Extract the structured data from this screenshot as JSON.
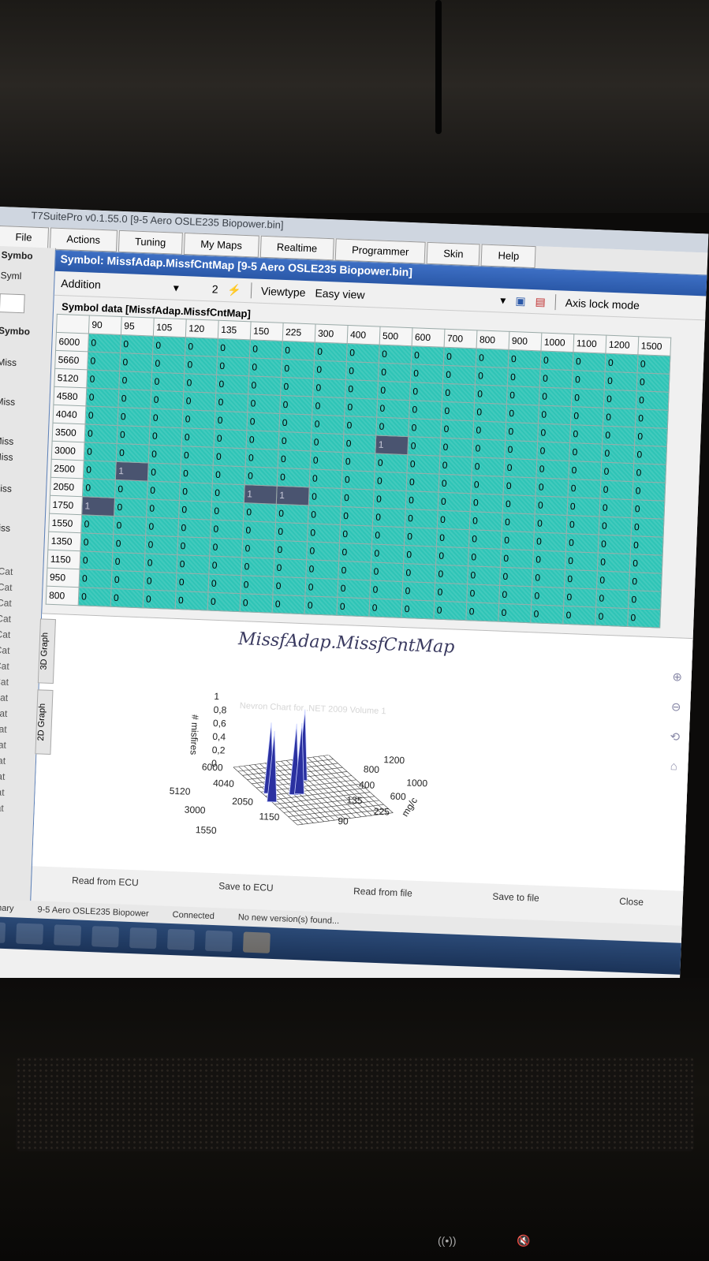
{
  "app": {
    "title": "T7SuitePro v0.1.55.0 [9-5 Aero OSLE235 Biopower.bin]"
  },
  "menu": [
    "File",
    "Actions",
    "Tuning",
    "My Maps",
    "Realtime",
    "Programmer",
    "Skin",
    "Help"
  ],
  "left_panel": {
    "tab1": "Symbo",
    "tab2": "Syml",
    "header": "Symbo",
    "items": [
      "Miss",
      "Miss",
      "Miss",
      "Miss",
      "Miss",
      "Miss"
    ],
    "cats": [
      "Cat",
      "Cat",
      "Cat",
      "Cat",
      "Cat",
      "Cat",
      "Cat",
      "Cat",
      "Cat",
      "Cat",
      "Cat",
      "Cat",
      "Cat",
      "Cat",
      "Cat",
      "Cat"
    ]
  },
  "dialog": {
    "title": "Symbol: MissfAdap.MissfCntMap [9-5 Aero OSLE235 Biopower.bin]",
    "toolbar": {
      "mode": "Addition",
      "value": "2",
      "viewtype_label": "Viewtype",
      "viewtype_value": "Easy view",
      "axis_lock": "Axis lock mode"
    },
    "group_title": "Symbol data [MissfAdap.MissfCntMap]",
    "columns": [
      "90",
      "95",
      "105",
      "120",
      "135",
      "150",
      "225",
      "300",
      "400",
      "500",
      "600",
      "700",
      "800",
      "900",
      "1000",
      "1100",
      "1200",
      "1500"
    ],
    "rows": [
      {
        "label": "6000",
        "values": [
          "0",
          "0",
          "0",
          "0",
          "0",
          "0",
          "0",
          "0",
          "0",
          "0",
          "0",
          "0",
          "0",
          "0",
          "0",
          "0",
          "0",
          "0"
        ]
      },
      {
        "label": "5660",
        "values": [
          "0",
          "0",
          "0",
          "0",
          "0",
          "0",
          "0",
          "0",
          "0",
          "0",
          "0",
          "0",
          "0",
          "0",
          "0",
          "0",
          "0",
          "0"
        ]
      },
      {
        "label": "5120",
        "values": [
          "0",
          "0",
          "0",
          "0",
          "0",
          "0",
          "0",
          "0",
          "0",
          "0",
          "0",
          "0",
          "0",
          "0",
          "0",
          "0",
          "0",
          "0"
        ]
      },
      {
        "label": "4580",
        "values": [
          "0",
          "0",
          "0",
          "0",
          "0",
          "0",
          "0",
          "0",
          "0",
          "0",
          "0",
          "0",
          "0",
          "0",
          "0",
          "0",
          "0",
          "0"
        ]
      },
      {
        "label": "4040",
        "values": [
          "0",
          "0",
          "0",
          "0",
          "0",
          "0",
          "0",
          "0",
          "0",
          "0",
          "0",
          "0",
          "0",
          "0",
          "0",
          "0",
          "0",
          "0"
        ]
      },
      {
        "label": "3500",
        "values": [
          "0",
          "0",
          "0",
          "0",
          "0",
          "0",
          "0",
          "0",
          "0",
          "1",
          "0",
          "0",
          "0",
          "0",
          "0",
          "0",
          "0",
          "0"
        ]
      },
      {
        "label": "3000",
        "values": [
          "0",
          "0",
          "0",
          "0",
          "0",
          "0",
          "0",
          "0",
          "0",
          "0",
          "0",
          "0",
          "0",
          "0",
          "0",
          "0",
          "0",
          "0"
        ]
      },
      {
        "label": "2500",
        "values": [
          "0",
          "1",
          "0",
          "0",
          "0",
          "0",
          "0",
          "0",
          "0",
          "0",
          "0",
          "0",
          "0",
          "0",
          "0",
          "0",
          "0",
          "0"
        ]
      },
      {
        "label": "2050",
        "values": [
          "0",
          "0",
          "0",
          "0",
          "0",
          "1",
          "1",
          "0",
          "0",
          "0",
          "0",
          "0",
          "0",
          "0",
          "0",
          "0",
          "0",
          "0"
        ]
      },
      {
        "label": "1750",
        "values": [
          "1",
          "0",
          "0",
          "0",
          "0",
          "0",
          "0",
          "0",
          "0",
          "0",
          "0",
          "0",
          "0",
          "0",
          "0",
          "0",
          "0",
          "0"
        ]
      },
      {
        "label": "1550",
        "values": [
          "0",
          "0",
          "0",
          "0",
          "0",
          "0",
          "0",
          "0",
          "0",
          "0",
          "0",
          "0",
          "0",
          "0",
          "0",
          "0",
          "0",
          "0"
        ]
      },
      {
        "label": "1350",
        "values": [
          "0",
          "0",
          "0",
          "0",
          "0",
          "0",
          "0",
          "0",
          "0",
          "0",
          "0",
          "0",
          "0",
          "0",
          "0",
          "0",
          "0",
          "0"
        ]
      },
      {
        "label": "1150",
        "values": [
          "0",
          "0",
          "0",
          "0",
          "0",
          "0",
          "0",
          "0",
          "0",
          "0",
          "0",
          "0",
          "0",
          "0",
          "0",
          "0",
          "0",
          "0"
        ]
      },
      {
        "label": "950",
        "values": [
          "0",
          "0",
          "0",
          "0",
          "0",
          "0",
          "0",
          "0",
          "0",
          "0",
          "0",
          "0",
          "0",
          "0",
          "0",
          "0",
          "0",
          "0"
        ]
      },
      {
        "label": "800",
        "values": [
          "0",
          "0",
          "0",
          "0",
          "0",
          "0",
          "0",
          "0",
          "0",
          "0",
          "0",
          "0",
          "0",
          "0",
          "0",
          "0",
          "0",
          "0"
        ]
      }
    ],
    "graph": {
      "title": "MissfAdap.MissfCntMap",
      "tab_3d": "3D Graph",
      "tab_2d": "2D Graph",
      "z_label": "# misfires",
      "z_ticks": [
        "1",
        "0,8",
        "0,6",
        "0,4",
        "0,2",
        "0"
      ],
      "y_ticks": [
        "6000",
        "5120",
        "4040",
        "3000",
        "2050",
        "1550",
        "1150"
      ],
      "x_ticks": [
        "1200",
        "800",
        "1000",
        "400",
        "600",
        "135",
        "225",
        "90"
      ],
      "x_label": "mg/c",
      "watermark": "Nevron Chart for .NET 2009 Volume 1"
    },
    "buttons": {
      "read_ecu": "Read from ECU",
      "save_ecu": "Save to ECU",
      "read_file": "Read from file",
      "save_file": "Save to file",
      "close": "Close"
    }
  },
  "status": {
    "left": "nal binary",
    "file": "9-5 Aero OSLE235 Biopower",
    "conn": "Connected",
    "update": "No new version(s) found..."
  },
  "colors": {
    "cell": "#2ec4b6",
    "highlight": "#4a5470",
    "title_bar": "#2a58a8"
  }
}
